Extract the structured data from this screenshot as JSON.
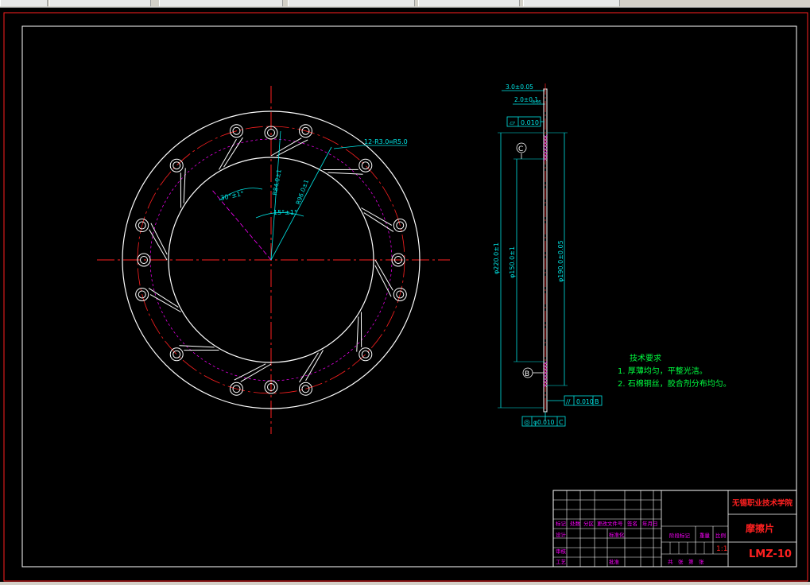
{
  "app": {
    "toolbar_cells": [
      "",
      "",
      "",
      "",
      "",
      ""
    ]
  },
  "colors": {
    "background": "#000000",
    "outline": "#ffffff",
    "centerline": "#ff2020",
    "dimension": "#00e5e5",
    "note_text": "#00ff40",
    "hidden_edge": "#ff00ff",
    "titleblock_red": "#ff2020",
    "titleblock_magenta": "#ff00ff"
  },
  "front_view": {
    "callout_holes": "12-R3.0¤R5.0",
    "angle_major": "30°±1°",
    "angle_minor": "15°±1°",
    "radius_inner": "R84.0±1",
    "radius_outer": "R96.0±1"
  },
  "side_view": {
    "thickness_total": "3.0±0.05",
    "thickness_core": "2.0±0.1",
    "tol_core": "-0.05",
    "dia_outer": "φ220.0±1",
    "dia_inner": "φ150.0±1",
    "dia_mid": "φ190.0±0.05",
    "datum_c": "C",
    "datum_b": "B",
    "flatness_sym": "▱",
    "flatness_val": "0.010",
    "parallel_sym": "//",
    "parallel_val": "0.010",
    "parallel_ref": "B",
    "concentric_sym": "◎",
    "concentric_val": "φ0.010",
    "concentric_ref": "C"
  },
  "tech_notes": {
    "title": "技术要求",
    "line1": "1. 厚薄均匀，平整光洁。",
    "line2": "2. 石棉铜丝，胶合剂分布均匀。"
  },
  "title_block": {
    "school": "无锡职业技术学院",
    "part_name": "摩擦片",
    "drawing_no": "LMZ-10",
    "scale": "1:1",
    "labels": {
      "mark": "标记",
      "count": "处数",
      "zone": "分区",
      "change_doc": "更改文件号",
      "sign": "签名",
      "date": "年月日",
      "design": "设计",
      "standardize": "标准化",
      "review": "审核",
      "process": "工艺",
      "approve": "批准",
      "stage_mark": "阶段标记",
      "weight": "重量",
      "ratio": "比例",
      "sheets": "共　张　第　张"
    }
  }
}
